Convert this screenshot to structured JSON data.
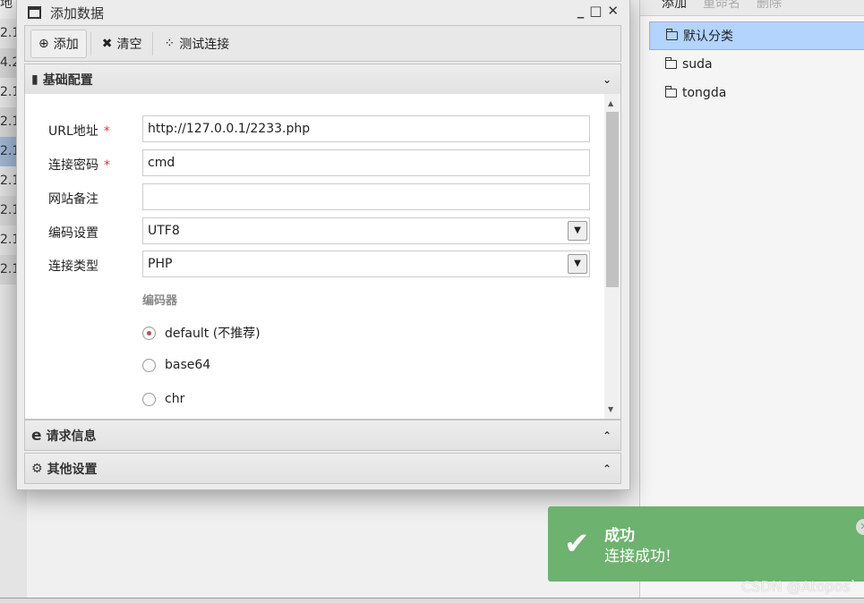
{
  "background_list": {
    "header": "地",
    "rows": [
      "2.1",
      "4.2",
      "2.1",
      "2.1",
      "2.1",
      "2.1",
      "2.1",
      "2.1",
      "2.1"
    ]
  },
  "dialog": {
    "title": "添加数据",
    "toolbar": {
      "add": "添加",
      "clear": "清空",
      "test": "测试连接"
    },
    "sections": {
      "basic": "基础配置",
      "request": "请求信息",
      "other": "其他设置"
    },
    "form": {
      "url_label": "URL地址",
      "url_value": "http://127.0.0.1/2233.php",
      "password_label": "连接密码",
      "password_value": "cmd",
      "note_label": "网站备注",
      "note_value": "",
      "encoding_label": "编码设置",
      "encoding_value": "UTF8",
      "type_label": "连接类型",
      "type_value": "PHP",
      "encoder_label": "编码器",
      "required_mark": "*",
      "encoders": [
        {
          "label": "default (不推荐)",
          "checked": true
        },
        {
          "label": "base64",
          "checked": false
        },
        {
          "label": "chr",
          "checked": false
        }
      ]
    }
  },
  "category_panel": {
    "toolbar": [
      "添加",
      "重命名",
      "删除"
    ],
    "items": [
      "默认分类",
      "suda",
      "tongda"
    ],
    "selected": "默认分类"
  },
  "toast": {
    "title": "成功",
    "message": "连接成功!",
    "color": "#6db26f"
  },
  "watermark": "CSDN @Atopos`"
}
